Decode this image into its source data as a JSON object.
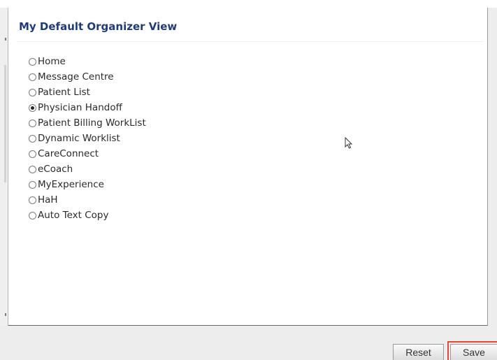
{
  "panel": {
    "title": "My Default Organizer View"
  },
  "options": [
    {
      "label": "Home",
      "checked": false
    },
    {
      "label": "Message Centre",
      "checked": false
    },
    {
      "label": "Patient List",
      "checked": false
    },
    {
      "label": "Physician Handoff",
      "checked": true
    },
    {
      "label": "Patient Billing WorkList",
      "checked": false
    },
    {
      "label": "Dynamic Worklist",
      "checked": false
    },
    {
      "label": "CareConnect",
      "checked": false
    },
    {
      "label": "eCoach",
      "checked": false
    },
    {
      "label": "MyExperience",
      "checked": false
    },
    {
      "label": "HaH",
      "checked": false
    },
    {
      "label": "Auto Text Copy",
      "checked": false
    }
  ],
  "buttons": {
    "reset": "Reset",
    "save": "Save"
  },
  "colors": {
    "title": "#1f3c78",
    "save_highlight": "#e0473f"
  }
}
